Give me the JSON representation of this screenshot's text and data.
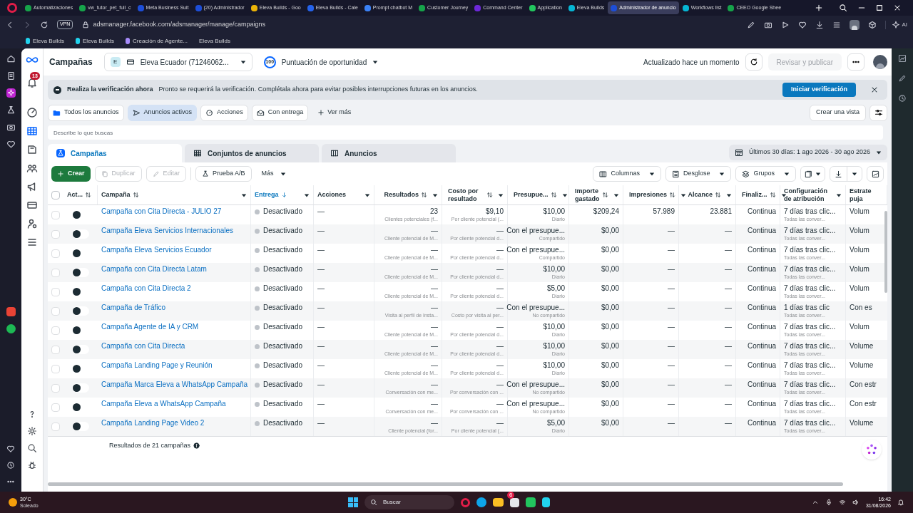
{
  "browser": {
    "tabs": [
      {
        "title": "Automatizaciones",
        "color": "#16a34a",
        "selected": false
      },
      {
        "title": "vw_tutor_pet_full_c",
        "color": "#16a34a",
        "selected": false
      },
      {
        "title": "Meta Business Suit",
        "color": "#1d4ed8",
        "selected": false
      },
      {
        "title": "(20) Administrador",
        "color": "#1d4ed8",
        "selected": false
      },
      {
        "title": "Eleva Builds - Goo",
        "color": "#eab308",
        "selected": false
      },
      {
        "title": "Eleva Builds - Cale",
        "color": "#2563eb",
        "selected": false
      },
      {
        "title": "Prompt chatbot M",
        "color": "#3b82f6",
        "selected": false
      },
      {
        "title": "Customer Journey",
        "color": "#16a34a",
        "selected": false
      },
      {
        "title": "Command Center",
        "color": "#6d28d9",
        "selected": false
      },
      {
        "title": "Application",
        "color": "#22c55e",
        "selected": false
      },
      {
        "title": "Eleva Builds",
        "color": "#06b6d4",
        "selected": false
      },
      {
        "title": "Administrador de anuncio",
        "color": "#1d4ed8",
        "selected": true
      },
      {
        "title": "Workflows list",
        "color": "#06b6d4",
        "selected": false
      },
      {
        "title": "CEEO Google Shee",
        "color": "#16a34a",
        "selected": false
      }
    ],
    "vpn": "VPN",
    "url": "adsmanager.facebook.com/adsmanager/manage/campaigns",
    "ai": "AI",
    "bookmarks": [
      "Eleva Builds",
      "Eleva Builds",
      "Creación de Agente...",
      "Eleva Builds"
    ]
  },
  "nav": {
    "badge": "13"
  },
  "header": {
    "title": "Campañas",
    "account": {
      "initial": "E",
      "name": "Eleva Ecuador (71246062..."
    },
    "score": {
      "value": "100",
      "label": "Puntuación de oportunidad"
    },
    "updated": "Actualizado hace un momento",
    "review": {
      "label": "Revisar y publicar",
      "disabled": true
    }
  },
  "banner": {
    "title": "Realiza la verificación ahora",
    "text": "Pronto se requerirá la verificación. Complétala ahora para evitar posibles interrupciones futuras en los anuncios.",
    "button": "Iniciar verificación"
  },
  "filters": [
    {
      "label": "Todos los anuncios",
      "selected": false
    },
    {
      "label": "Anuncios activos",
      "selected": true
    },
    {
      "label": "Acciones",
      "selected": false
    },
    {
      "label": "Con entrega",
      "selected": false
    }
  ],
  "more_filters": "Ver más",
  "create_view": "Crear una vista",
  "search": {
    "placeholder": "Describe lo que buscas"
  },
  "levels": [
    {
      "label": "Campañas",
      "selected": true
    },
    {
      "label": "Conjuntos de anuncios",
      "selected": false
    },
    {
      "label": "Anuncios",
      "selected": false
    }
  ],
  "date_range": "Últimos 30 días: 1 ago 2026 - 30 ago 2026",
  "toolbar": {
    "left": [
      {
        "label": "Crear",
        "kind": "primary",
        "disabled": false
      },
      {
        "label": "Duplicar",
        "kind": "duplicate",
        "disabled": true
      },
      {
        "label": "Editar",
        "kind": "edit",
        "disabled": true
      },
      {
        "label": "Prueba A/B",
        "kind": "test",
        "disabled": false
      },
      {
        "label": "Más",
        "kind": "menu",
        "disabled": false
      }
    ],
    "right": [
      {
        "label": "Columnas",
        "kind": "columns"
      },
      {
        "label": "Desglose",
        "kind": "breakdown"
      },
      {
        "label": "Grupos",
        "kind": "groups"
      }
    ]
  },
  "table": {
    "all_selected": false,
    "columns": [
      {
        "label": "Act...",
        "sortable": true,
        "sorted": false,
        "menu": false
      },
      {
        "label": "Campaña",
        "sortable": true,
        "sorted": false,
        "menu": true
      },
      {
        "label": "Entrega",
        "sortable": false,
        "sorted": true,
        "menu": true
      },
      {
        "label": "Acciones",
        "sortable": false,
        "sorted": false,
        "menu": true
      },
      {
        "label": "Resultados",
        "sortable": true,
        "sorted": false,
        "menu": true
      },
      {
        "label": "Costo por resultado",
        "sortable": true,
        "sorted": false,
        "menu": true
      },
      {
        "label": "Presupue...",
        "sortable": true,
        "sorted": false,
        "menu": true
      },
      {
        "label": "Importe gastado",
        "sortable": true,
        "sorted": false,
        "menu": true
      },
      {
        "label": "Impresiones",
        "sortable": true,
        "sorted": false,
        "menu": true
      },
      {
        "label": "Alcance",
        "sortable": true,
        "sorted": false,
        "menu": true
      },
      {
        "label": "Finaliz...",
        "sortable": true,
        "sorted": false,
        "menu": true
      },
      {
        "label": "Configuración de atribución",
        "sortable": false,
        "sorted": false,
        "menu": true
      },
      {
        "label": "Estrate puja",
        "sortable": false,
        "sorted": false,
        "menu": false
      }
    ],
    "rows": [
      {
        "selected": false,
        "on": false,
        "name": "Campaña con Cita Directa - JULIO 27",
        "delivery": "Desactivado",
        "actions": "—",
        "results": {
          "value": "23",
          "sub": "Clientes potenciales (f..."
        },
        "cost": {
          "value": "$9,10",
          "sub": "Por cliente potencial (..."
        },
        "budget": {
          "value": "$10,00",
          "sub": "Diario"
        },
        "spent": "$209,24",
        "impressions": "57.989",
        "reach": "23.881",
        "ends": "Continua",
        "attribution": {
          "value": "7 días tras clic...",
          "sub": "Todas las conver..."
        },
        "strategy": "Volum"
      },
      {
        "selected": false,
        "on": false,
        "name": "Campaña Eleva Servicios Internacionales",
        "delivery": "Desactivado",
        "actions": "—",
        "results": {
          "value": "—",
          "sub": "Cliente potencial de M..."
        },
        "cost": {
          "value": "—",
          "sub": "Por cliente potencial d..."
        },
        "budget": {
          "value": "Con el presupue...",
          "sub": "Compartido"
        },
        "spent": "$0,00",
        "impressions": "—",
        "reach": "—",
        "ends": "Continua",
        "attribution": {
          "value": "7 días tras clic...",
          "sub": "Todas las conver..."
        },
        "strategy": "Volum"
      },
      {
        "selected": false,
        "on": false,
        "name": "Campaña Eleva Servicios Ecuador",
        "delivery": "Desactivado",
        "actions": "—",
        "results": {
          "value": "—",
          "sub": "Cliente potencial de M..."
        },
        "cost": {
          "value": "—",
          "sub": "Por cliente potencial d..."
        },
        "budget": {
          "value": "Con el presupue...",
          "sub": "Compartido"
        },
        "spent": "$0,00",
        "impressions": "—",
        "reach": "—",
        "ends": "Continua",
        "attribution": {
          "value": "7 días tras clic...",
          "sub": "Todas las conver..."
        },
        "strategy": "Volum"
      },
      {
        "selected": false,
        "on": false,
        "name": "Campaña con Cita Directa Latam",
        "delivery": "Desactivado",
        "actions": "—",
        "results": {
          "value": "—",
          "sub": "Cliente potencial de M..."
        },
        "cost": {
          "value": "—",
          "sub": "Por cliente potencial d..."
        },
        "budget": {
          "value": "$10,00",
          "sub": "Diario"
        },
        "spent": "$0,00",
        "impressions": "—",
        "reach": "—",
        "ends": "Continua",
        "attribution": {
          "value": "7 días tras clic...",
          "sub": "Todas las conver..."
        },
        "strategy": "Volum"
      },
      {
        "selected": false,
        "on": false,
        "name": "Campaña con Cita Directa 2",
        "delivery": "Desactivado",
        "actions": "—",
        "results": {
          "value": "—",
          "sub": "Cliente potencial de M..."
        },
        "cost": {
          "value": "—",
          "sub": "Por cliente potencial d..."
        },
        "budget": {
          "value": "$5,00",
          "sub": "Diario"
        },
        "spent": "$0,00",
        "impressions": "—",
        "reach": "—",
        "ends": "Continua",
        "attribution": {
          "value": "7 días tras clic...",
          "sub": "Todas las conver..."
        },
        "strategy": "Volum"
      },
      {
        "selected": false,
        "on": false,
        "name": "Campaña de Tráfico",
        "delivery": "Desactivado",
        "actions": "—",
        "results": {
          "value": "—",
          "sub": "Visita al perfil de Insta..."
        },
        "cost": {
          "value": "—",
          "sub": "Costo por visita al per..."
        },
        "budget": {
          "value": "Con el presupue...",
          "sub": "No compartido"
        },
        "spent": "$0,00",
        "impressions": "—",
        "reach": "—",
        "ends": "Continua",
        "attribution": {
          "value": "1 días tras clic",
          "sub": "Todas las conver..."
        },
        "strategy": "Con es"
      },
      {
        "selected": false,
        "on": false,
        "name": "Campaña Agente de IA y CRM",
        "delivery": "Desactivado",
        "actions": "—",
        "results": {
          "value": "—",
          "sub": "Cliente potencial de M..."
        },
        "cost": {
          "value": "—",
          "sub": "Por cliente potencial d..."
        },
        "budget": {
          "value": "$10,00",
          "sub": "Diario"
        },
        "spent": "$0,00",
        "impressions": "—",
        "reach": "—",
        "ends": "Continua",
        "attribution": {
          "value": "7 días tras clic...",
          "sub": "Todas las conver..."
        },
        "strategy": "Volum"
      },
      {
        "selected": false,
        "on": false,
        "name": "Campaña con Cita Directa",
        "delivery": "Desactivado",
        "actions": "—",
        "results": {
          "value": "—",
          "sub": "Cliente potencial de M..."
        },
        "cost": {
          "value": "—",
          "sub": "Por cliente potencial d..."
        },
        "budget": {
          "value": "$10,00",
          "sub": "Diario"
        },
        "spent": "$0,00",
        "impressions": "—",
        "reach": "—",
        "ends": "Continua",
        "attribution": {
          "value": "7 días tras clic...",
          "sub": "Todas las conver..."
        },
        "strategy": "Volume"
      },
      {
        "selected": false,
        "on": false,
        "name": "Campaña Landing Page y Reunión",
        "delivery": "Desactivado",
        "actions": "—",
        "results": {
          "value": "—",
          "sub": "Cliente potencial de M..."
        },
        "cost": {
          "value": "—",
          "sub": "Por cliente potencial d..."
        },
        "budget": {
          "value": "$10,00",
          "sub": "Diario"
        },
        "spent": "$0,00",
        "impressions": "—",
        "reach": "—",
        "ends": "Continua",
        "attribution": {
          "value": "7 días tras clic...",
          "sub": "Todas las conver..."
        },
        "strategy": "Volume"
      },
      {
        "selected": false,
        "on": false,
        "name": "Campaña Marca Eleva a WhatsApp Campaña",
        "delivery": "Desactivado",
        "actions": "—",
        "results": {
          "value": "—",
          "sub": "Conversación con me..."
        },
        "cost": {
          "value": "—",
          "sub": "Por conversación con ..."
        },
        "budget": {
          "value": "Con el presupue...",
          "sub": "No compartido"
        },
        "spent": "$0,00",
        "impressions": "—",
        "reach": "—",
        "ends": "Continua",
        "attribution": {
          "value": "7 días tras clic...",
          "sub": "Todas las conver..."
        },
        "strategy": "Con estr"
      },
      {
        "selected": false,
        "on": false,
        "name": "Campaña Eleva a WhatsApp Campaña",
        "delivery": "Desactivado",
        "actions": "—",
        "results": {
          "value": "—",
          "sub": "Conversación con me..."
        },
        "cost": {
          "value": "—",
          "sub": "Por conversación con ..."
        },
        "budget": {
          "value": "Con el presupue...",
          "sub": "No compartido"
        },
        "spent": "$0,00",
        "impressions": "—",
        "reach": "—",
        "ends": "Continua",
        "attribution": {
          "value": "7 días tras clic...",
          "sub": "Todas las conver..."
        },
        "strategy": "Con estr"
      },
      {
        "selected": false,
        "on": false,
        "name": "Campaña Landing Page Video 2",
        "delivery": "Desactivado",
        "actions": "—",
        "results": {
          "value": "—",
          "sub": "Cliente potencial (for..."
        },
        "cost": {
          "value": "—",
          "sub": "Por cliente potencial (..."
        },
        "budget": {
          "value": "$5,00",
          "sub": "Diario"
        },
        "spent": "$0,00",
        "impressions": "—",
        "reach": "—",
        "ends": "Continua",
        "attribution": {
          "value": "7 días tras clic...",
          "sub": "Todas las conver..."
        },
        "strategy": "Volume"
      }
    ],
    "footer": "Resultados de 21 campañas"
  },
  "taskbar": {
    "temp": "30°C",
    "weather": "Soleado",
    "search": "Buscar",
    "whatsapp_badge": "6",
    "time": "16:42",
    "date": "31/08/2026"
  }
}
